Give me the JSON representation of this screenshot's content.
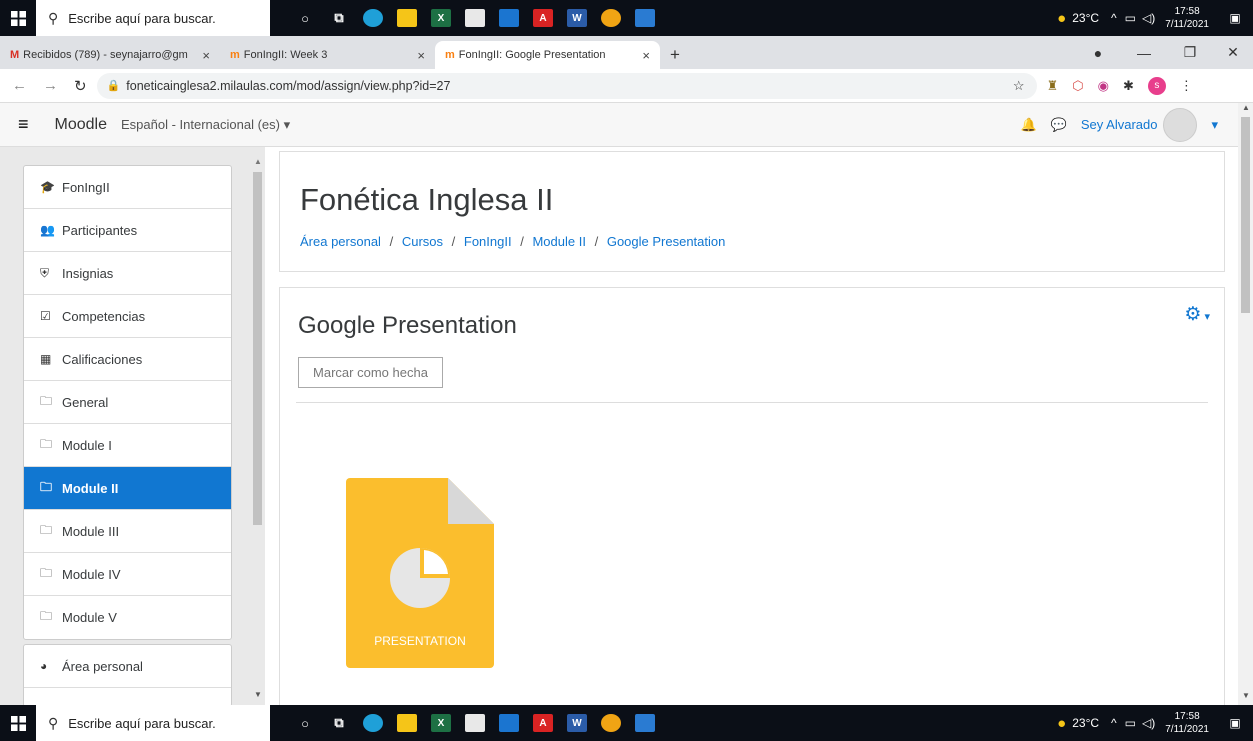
{
  "taskbar": {
    "search_placeholder": "Escribe aquí para buscar.",
    "weather": "23°C",
    "time": "17:58",
    "date": "7/11/2021"
  },
  "browser": {
    "tabs": [
      {
        "label": "Recibidos (789) - seynajarro@gm",
        "icon": "gmail-icon"
      },
      {
        "label": "FonIngII: Week 3",
        "icon": "moodle-icon"
      },
      {
        "label": "FonIngII: Google Presentation",
        "icon": "moodle-icon",
        "active": true
      }
    ],
    "url": "foneticainglesa2.milaulas.com/mod/assign/view.php?id=27",
    "profile_initial": "s"
  },
  "navbar": {
    "brand": "Moodle",
    "language": "Español - Internacional (es)",
    "user_name": "Sey Alvarado"
  },
  "sidebar": {
    "items": [
      {
        "label": "FonIngII",
        "icon": "graduation-cap-icon"
      },
      {
        "label": "Participantes",
        "icon": "users-icon"
      },
      {
        "label": "Insignias",
        "icon": "shield-icon"
      },
      {
        "label": "Competencias",
        "icon": "check-square-icon"
      },
      {
        "label": "Calificaciones",
        "icon": "table-icon"
      },
      {
        "label": "General",
        "icon": "folder-icon"
      },
      {
        "label": "Module I",
        "icon": "folder-icon"
      },
      {
        "label": "Module II",
        "icon": "folder-icon",
        "active": true
      },
      {
        "label": "Module III",
        "icon": "folder-icon"
      },
      {
        "label": "Module IV",
        "icon": "folder-icon"
      },
      {
        "label": "Module V",
        "icon": "folder-icon"
      }
    ],
    "dashboard": "Área personal"
  },
  "header": {
    "course_title": "Fonética Inglesa II",
    "breadcrumb": [
      "Área personal",
      "Cursos",
      "FonIngII",
      "Module II",
      "Google Presentation"
    ]
  },
  "activity": {
    "title": "Google Presentation",
    "mark_done_button": "Marcar como hecha",
    "file_label": "PRESENTATION"
  },
  "colors": {
    "accent": "#1177d1",
    "file_yellow": "#fbbe2d"
  }
}
